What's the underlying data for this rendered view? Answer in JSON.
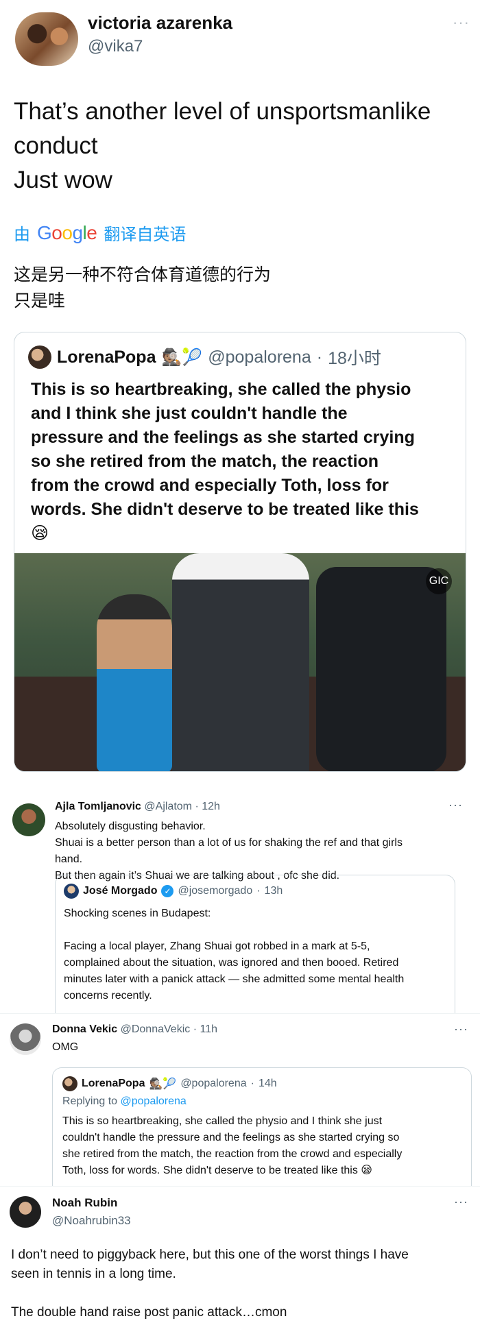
{
  "tweet_main": {
    "name": "victoria azarenka",
    "handle": "@vika7",
    "more": "···",
    "text_lines": [
      "That’s another level of unsportsmanlike",
      "conduct",
      "Just wow"
    ],
    "translate_prefix": "由",
    "translate_google_letters": [
      "G",
      "o",
      "o",
      "g",
      "l",
      "e"
    ],
    "translate_suffix": "翻译自英语",
    "translated_lines": [
      "这是另一种不符合体育道德的行为",
      "只是哇"
    ]
  },
  "quote_main": {
    "name": "LorenaPopa",
    "emojis": "🕵🏽🎾",
    "handle": "@popalorena",
    "dot": "·",
    "time": "18小时",
    "text_lines": [
      "This is so heartbreaking, she called the physio",
      "and I think she just couldn't handle the",
      "pressure and the feelings as she started crying",
      "so she retired from the match, the reaction",
      "from the crowd and especially Toth, loss for",
      "words. She didn't deserve to be treated like this"
    ],
    "text_emoji": "😪",
    "media_badge": "GIC"
  },
  "reply_ajla": {
    "name": "Ajla Tomljanovic",
    "handle": "@Ajlatom",
    "dot": "·",
    "time": "12h",
    "more": "···",
    "text_lines": [
      "Absolutely disgusting behavior.",
      "Shuai is a better person than a lot of us for shaking the ref and that girls",
      "hand.",
      "But then again it’s Shuai we are talking about , ofc she did."
    ],
    "quote": {
      "name": "José Morgado",
      "verified": "✓",
      "handle": "@josemorgado",
      "dot": "·",
      "time": "13h",
      "text_lines": [
        "Shocking scenes in Budapest:",
        "",
        "Facing a local player, Zhang Shuai got robbed in a mark at 5-5,",
        "complained about the situation, was ignored and then booed. Retired",
        "minutes later with a panick attack — she admitted some mental health",
        "concerns recently."
      ]
    }
  },
  "reply_donna": {
    "name": "Donna Vekic",
    "handle": "@DonnaVekic",
    "dot": "·",
    "time": "11h",
    "more": "···",
    "text": "OMG",
    "quote": {
      "name": "LorenaPopa",
      "emojis": "🕵🏽🎾",
      "handle": "@popalorena",
      "dot": "·",
      "time": "14h",
      "replying_prefix": "Replying to",
      "replying_to": "@popalorena",
      "text_lines": [
        "This is so heartbreaking, she called the physio and I think she just",
        "couldn't handle the pressure and the feelings as she started crying so",
        "she retired from the match, the reaction from the crowd and especially",
        "Toth, loss for words. She didn't deserve to be treated like this 😪"
      ]
    }
  },
  "tweet_noah": {
    "name": "Noah Rubin",
    "handle": "@Noahrubin33",
    "more": "···",
    "text_lines": [
      "I don’t need to piggyback here, but this one of the worst things I have",
      "seen in tennis in a long time."
    ],
    "text_line_after_gap": "The double hand raise post panic attack…cmon"
  }
}
